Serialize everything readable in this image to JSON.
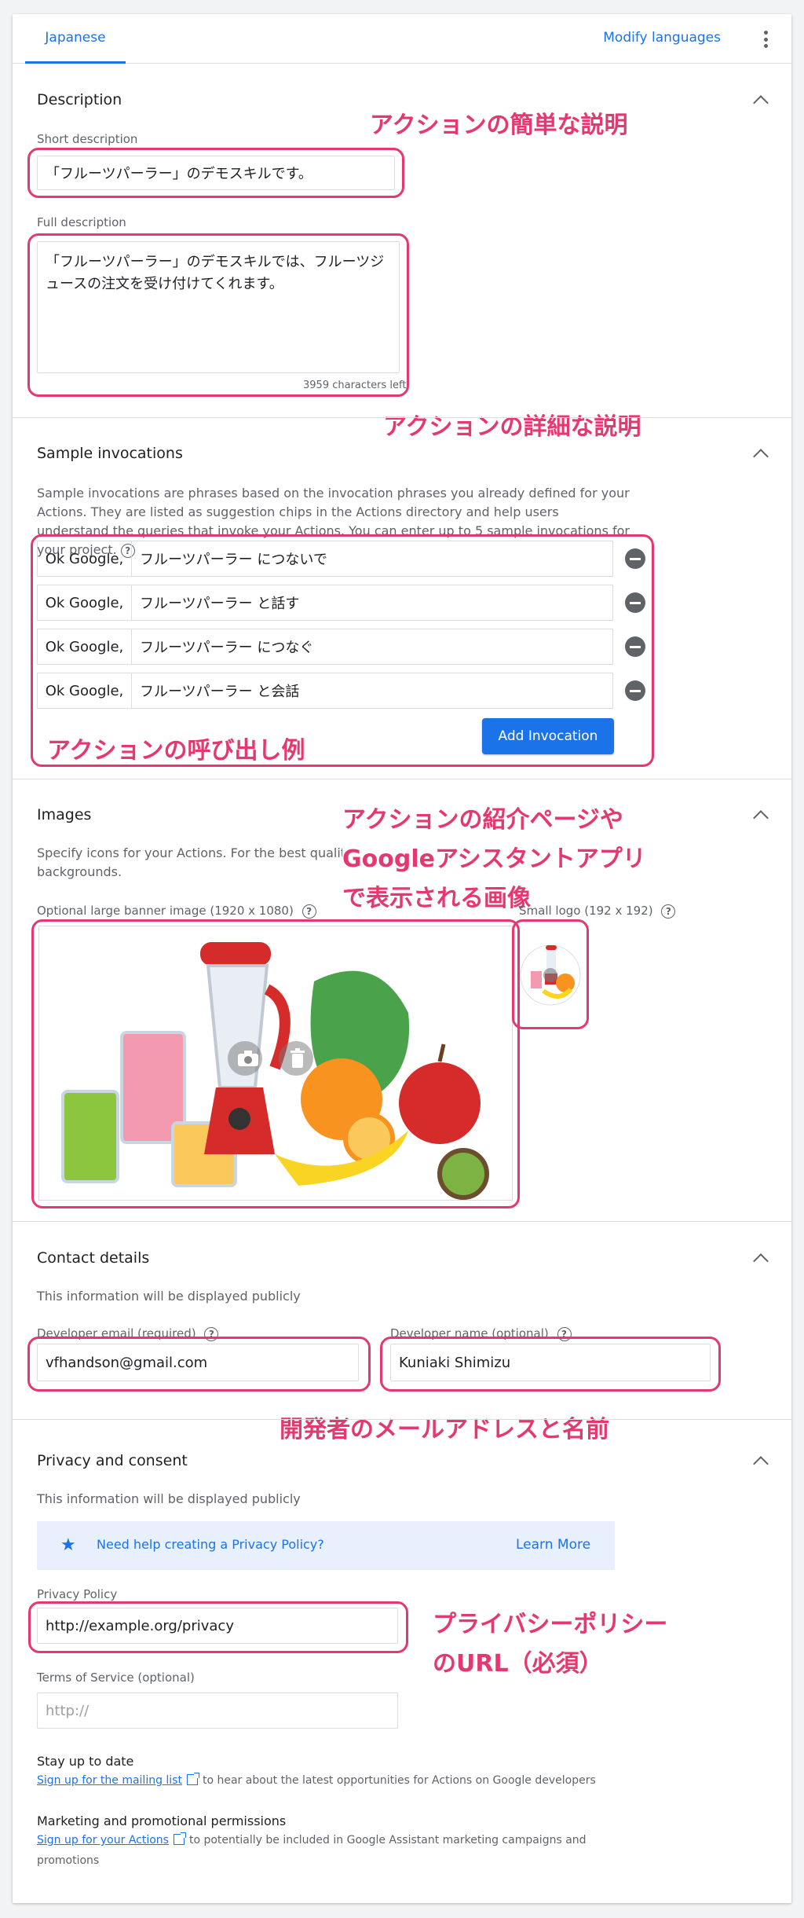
{
  "tabs": {
    "active": "Japanese",
    "modify": "Modify languages"
  },
  "description": {
    "title": "Description",
    "short_label": "Short description",
    "short_value": "「フルーツパーラー」のデモスキルです。",
    "full_label": "Full description",
    "full_value": "「フルーツパーラー」のデモスキルでは、フルーツジュースの注文を受け付けてくれます。",
    "chars_left": "3959 characters left"
  },
  "annotations": {
    "short": "アクションの簡単な説明",
    "full": "アクションの詳細な説明",
    "invocations": "アクションの呼び出し例",
    "images_line1": "アクションの紹介ページや",
    "images_line2": "Googleアシスタントアプリ",
    "images_line3": "で表示される画像",
    "contact": "開発者のメールアドレスと名前",
    "privacy_line1": "プライバシーポリシー",
    "privacy_line2": "のURL（必須）"
  },
  "sample_invocations": {
    "title": "Sample invocations",
    "help": "Sample invocations are phrases based on the invocation phrases you already defined for your Actions. They are listed as suggestion chips in the Actions directory and help users understand the queries that invoke your Actions. You can enter up to 5 sample invocations for your project.",
    "prefix": "Ok Google,",
    "items": [
      "フルーツパーラー につないで",
      "フルーツパーラー と話す",
      "フルーツパーラー につなぐ",
      "フルーツパーラー と会話"
    ],
    "add_button": "Add Invocation"
  },
  "images": {
    "title": "Images",
    "help": "Specify icons for your Actions. For the best quality, provide image files in PNG format with transparent backgrounds.",
    "help_visible": "Specify icons for your Actions. For the best qualit",
    "help_tail": "backgrounds.",
    "banner_label": "Optional large banner image (1920 x 1080)",
    "logo_label": "Small logo (192 x 192)"
  },
  "contact": {
    "title": "Contact details",
    "note": "This information will be displayed publicly",
    "email_label": "Developer email (required)",
    "email_value": "vfhandson@gmail.com",
    "name_label": "Developer name (optional)",
    "name_value": "Kuniaki Shimizu"
  },
  "privacy": {
    "title": "Privacy and consent",
    "note": "This information will be displayed publicly",
    "banner_text": "Need help creating a Privacy Policy?",
    "learn_more": "Learn More",
    "policy_label": "Privacy Policy",
    "policy_value": "http://example.org/privacy",
    "tos_label": "Terms of Service (optional)",
    "tos_placeholder": "http://",
    "stay_title": "Stay up to date",
    "stay_link": "Sign up for the mailing list",
    "stay_text": "to hear about the latest opportunities for Actions on Google developers",
    "marketing_title": "Marketing and promotional permissions",
    "marketing_link": "Sign up for your Actions",
    "marketing_text": "to potentially be included in Google Assistant marketing campaigns and",
    "marketing_text2": "promotions"
  },
  "colors": {
    "accent": "#1a73e8",
    "annotation": "#e5386f"
  }
}
